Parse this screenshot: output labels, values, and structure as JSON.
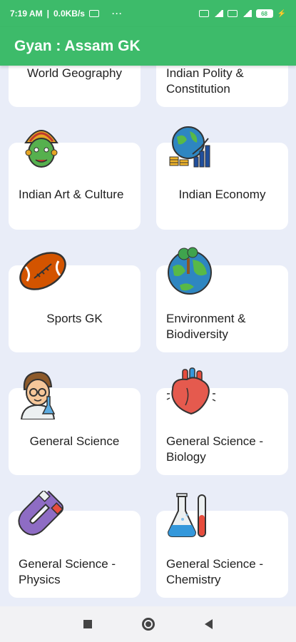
{
  "status_bar": {
    "time": "7:19 AM",
    "speed": "0.0KB/s",
    "separator": "|",
    "more": "···",
    "battery": "68"
  },
  "app": {
    "title": "Gyan : Assam GK"
  },
  "categories": [
    {
      "label": "World Geography",
      "icon": "globe-icon"
    },
    {
      "label": "Indian Polity & Constitution",
      "icon": "parliament-icon"
    },
    {
      "label": "Indian Art & Culture",
      "icon": "kathakali-mask-icon"
    },
    {
      "label": "Indian Economy",
      "icon": "economy-globe-chart-icon"
    },
    {
      "label": "Sports GK",
      "icon": "rugby-ball-icon"
    },
    {
      "label": "Environment & Biodiversity",
      "icon": "earth-tree-icon"
    },
    {
      "label": "General Science",
      "icon": "scientist-icon"
    },
    {
      "label": "General Science - Biology",
      "icon": "heart-organ-icon"
    },
    {
      "label": "General Science - Physics",
      "icon": "magnet-icon"
    },
    {
      "label": "General Science - Chemistry",
      "icon": "lab-flasks-icon"
    }
  ],
  "nav": {
    "recents": "recents-button",
    "home": "home-button",
    "back": "back-button"
  }
}
